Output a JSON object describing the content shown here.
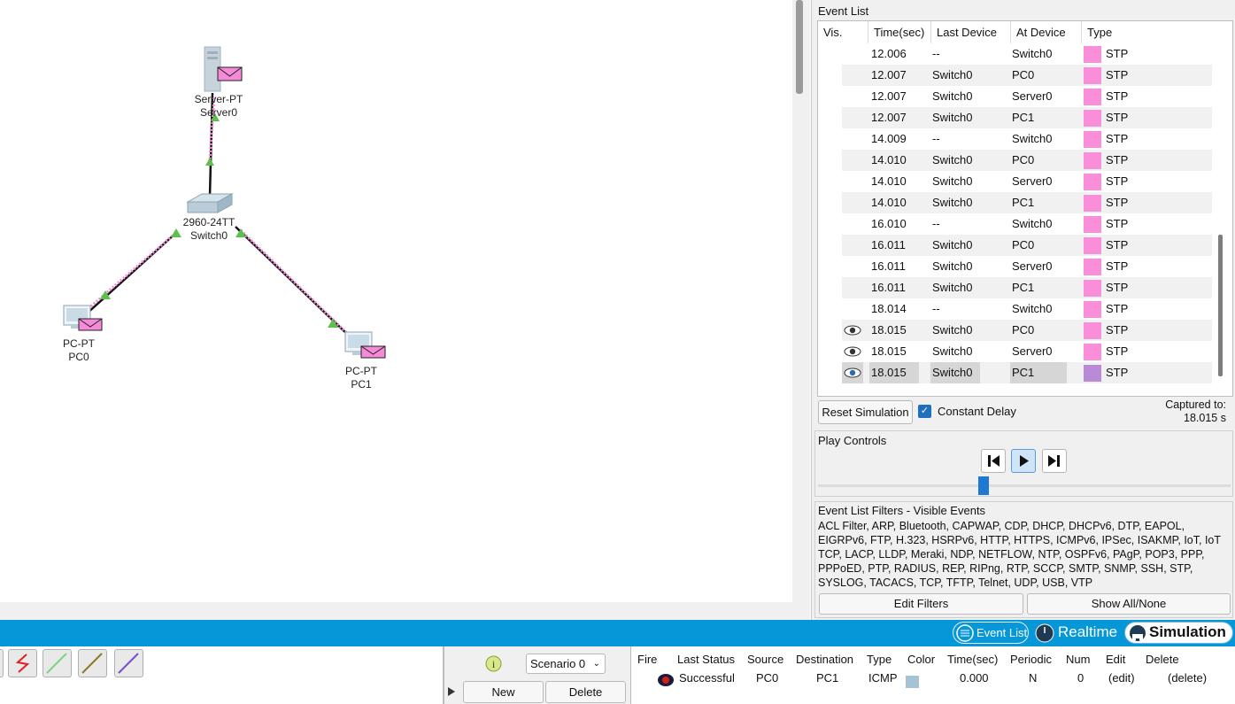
{
  "workspace": {
    "devices": [
      {
        "type_label": "Server-PT",
        "name": "Server0"
      },
      {
        "type_label": "2960-24TT",
        "name": "Switch0"
      },
      {
        "type_label": "PC-PT",
        "name": "PC0"
      },
      {
        "type_label": "PC-PT",
        "name": "PC1"
      }
    ]
  },
  "event_list": {
    "title": "Event List",
    "columns": [
      "Vis.",
      "Time(sec)",
      "Last Device",
      "At Device",
      "Type"
    ],
    "rows": [
      {
        "vis": "",
        "time": "12.006",
        "last": "--",
        "at": "Switch0",
        "type": "STP",
        "color": "#f88fd8"
      },
      {
        "vis": "",
        "time": "12.007",
        "last": "Switch0",
        "at": "PC0",
        "type": "STP",
        "color": "#f88fd8"
      },
      {
        "vis": "",
        "time": "12.007",
        "last": "Switch0",
        "at": "Server0",
        "type": "STP",
        "color": "#f88fd8"
      },
      {
        "vis": "",
        "time": "12.007",
        "last": "Switch0",
        "at": "PC1",
        "type": "STP",
        "color": "#f88fd8"
      },
      {
        "vis": "",
        "time": "14.009",
        "last": "--",
        "at": "Switch0",
        "type": "STP",
        "color": "#f88fd8"
      },
      {
        "vis": "",
        "time": "14.010",
        "last": "Switch0",
        "at": "PC0",
        "type": "STP",
        "color": "#f88fd8"
      },
      {
        "vis": "",
        "time": "14.010",
        "last": "Switch0",
        "at": "Server0",
        "type": "STP",
        "color": "#f88fd8"
      },
      {
        "vis": "",
        "time": "14.010",
        "last": "Switch0",
        "at": "PC1",
        "type": "STP",
        "color": "#f88fd8"
      },
      {
        "vis": "",
        "time": "16.010",
        "last": "--",
        "at": "Switch0",
        "type": "STP",
        "color": "#f88fd8"
      },
      {
        "vis": "",
        "time": "16.011",
        "last": "Switch0",
        "at": "PC0",
        "type": "STP",
        "color": "#f88fd8"
      },
      {
        "vis": "",
        "time": "16.011",
        "last": "Switch0",
        "at": "Server0",
        "type": "STP",
        "color": "#f88fd8"
      },
      {
        "vis": "",
        "time": "16.011",
        "last": "Switch0",
        "at": "PC1",
        "type": "STP",
        "color": "#f88fd8"
      },
      {
        "vis": "",
        "time": "18.014",
        "last": "--",
        "at": "Switch0",
        "type": "STP",
        "color": "#f88fd8"
      },
      {
        "vis": "eye-icon",
        "time": "18.015",
        "last": "Switch0",
        "at": "PC0",
        "type": "STP",
        "color": "#f88fd8"
      },
      {
        "vis": "eye-icon",
        "time": "18.015",
        "last": "Switch0",
        "at": "Server0",
        "type": "STP",
        "color": "#f88fd8"
      },
      {
        "vis": "eye-icon",
        "time": "18.015",
        "last": "Switch0",
        "at": "PC1",
        "type": "STP",
        "color": "#b98ad6",
        "selected": true
      }
    ],
    "reset_button": "Reset Simulation",
    "constant_delay_label": "Constant Delay",
    "constant_delay_checked": true,
    "captured_label": "Captured to:",
    "captured_value": "18.015 s"
  },
  "play_controls": {
    "title": "Play Controls",
    "slider_position": 0.39
  },
  "filters": {
    "title": "Event List Filters - Visible Events",
    "text": "ACL Filter, ARP, Bluetooth, CAPWAP, CDP, DHCP, DHCPv6, DTP, EAPOL, EIGRPv6, FTP, H.323, HSRPv6, HTTP, HTTPS, ICMPv6, IPSec, ISAKMP, IoT, IoT TCP, LACP, LLDP, Meraki, NDP, NETFLOW, NTP, OSPFv6, PAgP, POP3, PPP, PPPoED, PTP, RADIUS, REP, RIPng, RTP, SCCP, SMTP, SNMP, SSH, STP, SYSLOG, TACACS, TCP, TFTP, Telnet, UDP, USB, VTP",
    "edit_button": "Edit Filters",
    "show_all_button": "Show All/None"
  },
  "mode_bar": {
    "event_list_button": "Event List",
    "realtime_button": "Realtime",
    "simulation_button": "Simulation",
    "bar_color": "#0597d8"
  },
  "scenario": {
    "selected": "Scenario 0",
    "new_button": "New",
    "delete_button": "Delete"
  },
  "pdu_table": {
    "columns": [
      "Fire",
      "Last Status",
      "Source",
      "Destination",
      "Type",
      "Color",
      "Time(sec)",
      "Periodic",
      "Num",
      "Edit",
      "Delete"
    ],
    "rows": [
      {
        "fire": "",
        "status": "Successful",
        "source": "PC0",
        "destination": "PC1",
        "type": "ICMP",
        "color": "#a6c3d6",
        "time": "0.000",
        "periodic": "N",
        "num": "0",
        "edit": "(edit)",
        "delete": "(delete)"
      }
    ]
  },
  "connections": [
    {
      "name": "crossover-cable",
      "color": "#e02020"
    },
    {
      "name": "straight-green",
      "color": "#7ed47e"
    },
    {
      "name": "straight-olive",
      "color": "#8a7a2a"
    },
    {
      "name": "straight-purple",
      "color": "#7a4fc8"
    }
  ]
}
